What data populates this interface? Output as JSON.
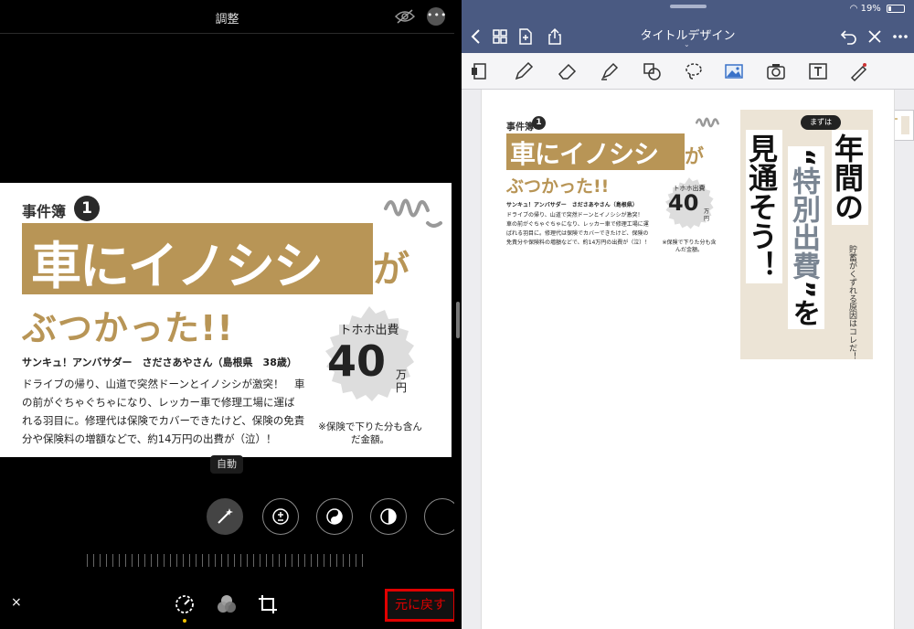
{
  "left_pane": {
    "title": "調整",
    "more_label": "•••",
    "photo": {
      "case_label": "事件簿",
      "case_number": "1",
      "headline": "車にイノシシ",
      "headline_suffix": "が",
      "subheadline": "ぶつかった!!",
      "byline": "サンキュ！アンバサダー　さださあやさん（島根県　38歳）",
      "body": "ドライブの帰り、山道で突然ドーンとイノシシが激突！　車の前がぐちゃぐちゃになり、レッカー車で修理工場に運ばれる羽目に。修理代は保険でカバーできたけど、保険の免責分や保険料の増額などで、約14万円の出費が（泣）！",
      "stamp_label": "トホホ出費",
      "stamp_amount": "40",
      "stamp_unit": "万円",
      "note": "※保険で下りた分も含んだ金額。"
    },
    "auto_label": "自動",
    "close_label": "×",
    "revert_label": "元に戻す"
  },
  "right_pane": {
    "status": {
      "battery": "19%"
    },
    "doc_title": "タイトルデザイン",
    "chevron": "⌄",
    "page": {
      "case_label": "事件簿",
      "case_number": "1",
      "headline": "車にイノシシ",
      "headline_suffix": "が",
      "subheadline": "ぶつかった!!",
      "byline": "サンキュ！アンバサダー　さださあやさん（島根県）",
      "body": "ドライブの帰り、山道で突然ドーンとイノシシが激突！　車の前がぐちゃぐちゃになり、レッカー車で修理工場に運ばれる羽目に。修理代は保険でカバーできたけど、保険の免責分や保険料の増額などで、約14万円の出費が（泣）！",
      "stamp_label": "トホホ出費",
      "stamp_amount": "40",
      "stamp_unit": "万円",
      "note": "※保険で下りた分も含んだ金額。",
      "cover_badge": "まずは",
      "cover_col1": "年間の",
      "cover_col2_pre": "“",
      "cover_col2_main": "特別出費",
      "cover_col2_post": "”を",
      "cover_col3": "見通そう！",
      "cover_small": "貯蓄がくずれる原因はコレだ！"
    }
  },
  "colors": {
    "accent_gold": "#b89556",
    "header_blue": "#4a5a82",
    "revert_red": "#e00000"
  }
}
